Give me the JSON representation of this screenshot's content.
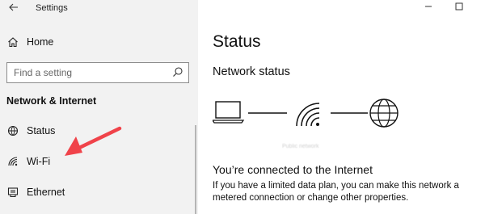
{
  "window": {
    "title": "Settings"
  },
  "sidebar": {
    "home_label": "Home",
    "search_placeholder": "Find a setting",
    "section_title": "Network & Internet",
    "items": [
      {
        "label": "Status",
        "icon": "status-globe-icon"
      },
      {
        "label": "Wi-Fi",
        "icon": "wifi-icon"
      },
      {
        "label": "Ethernet",
        "icon": "ethernet-icon"
      }
    ]
  },
  "main": {
    "title": "Status",
    "network_status_heading": "Network status",
    "network_name": "Public network",
    "connected_heading": "You’re connected to the Internet",
    "connected_desc": "If you have a limited data plan, you can make this network a metered connection or change other properties."
  },
  "annotation": {
    "arrow_color": "#f0434a"
  },
  "colors": {
    "sidebar_bg": "#f2f2f2",
    "main_bg": "#ffffff"
  }
}
